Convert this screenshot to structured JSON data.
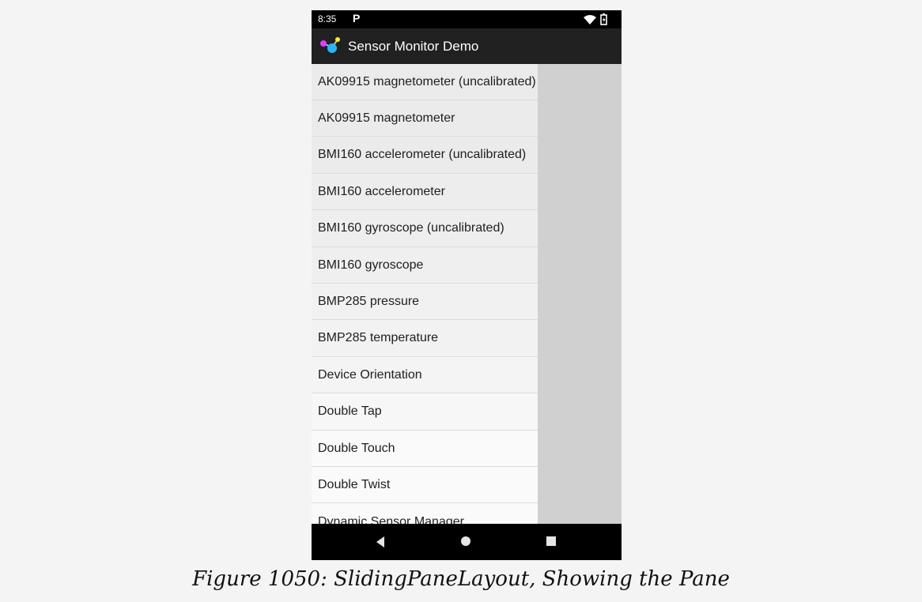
{
  "status_bar": {
    "time": "8:35",
    "notification_icon": "P",
    "icons": [
      "wifi-icon",
      "battery-icon"
    ]
  },
  "app_bar": {
    "title": "Sensor Monitor Demo",
    "icon": "app-molecule-icon"
  },
  "sensor_list": [
    "AK09915 magnetometer (uncalibrated)",
    "AK09915 magnetometer",
    "BMI160 accelerometer (uncalibrated)",
    "BMI160 accelerometer",
    "BMI160 gyroscope (uncalibrated)",
    "BMI160 gyroscope",
    "BMP285 pressure",
    "BMP285 temperature",
    "Device Orientation",
    "Double Tap",
    "Double Touch",
    "Double Twist",
    "Dynamic Sensor Manager"
  ],
  "nav_bar": {
    "icons": [
      "back-icon",
      "home-icon",
      "recents-icon"
    ]
  },
  "caption": "Figure 1050: SlidingPaneLayout, Showing the Pane"
}
